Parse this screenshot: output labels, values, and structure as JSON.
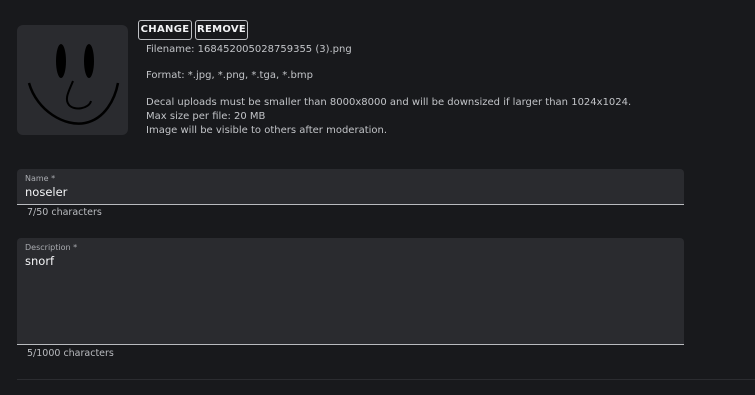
{
  "decal": {
    "preview_icon": "smiley-face-icon",
    "change_label": "CHANGE",
    "remove_label": "REMOVE",
    "filename": "Filename: 1684520050287593​55 (3).png",
    "format": "Format: *.jpg, *.png, *.tga, *.bmp",
    "size_note": "Decal uploads must be smaller than 8000x8000 and will be downsized if larger than 1024x1024.",
    "max_size": "Max size per file: 20 MB",
    "moderation_note": "Image will be visible to others after moderation."
  },
  "form": {
    "name": {
      "label": "Name *",
      "value": "noseler",
      "counter": "7/50 characters"
    },
    "description": {
      "label": "Description *",
      "value": "snorf",
      "counter": "5/1000 characters"
    }
  },
  "colors": {
    "background": "#18191c",
    "field_bg": "#2a2b2f",
    "text": "#c9cbcf"
  }
}
